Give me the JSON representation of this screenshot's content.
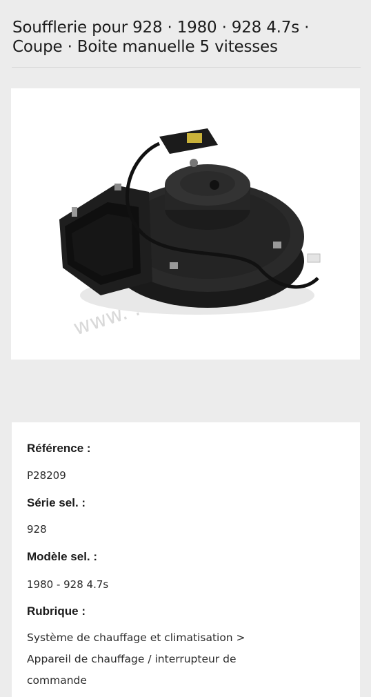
{
  "product": {
    "title_line1": "Soufflerie pour 928 · 1980 · 928 4.7s ·",
    "title_line2": "Coupe · Boite manuelle 5 vitesses",
    "image_alt": "Soufflerie (blower motor)",
    "watermark": "www.                    .com"
  },
  "details": {
    "reference_label": "Référence :",
    "reference_value": "P28209",
    "serie_label": "Série sel. :",
    "serie_value": "928",
    "modele_label": "Modèle sel. :",
    "modele_value": "1980 - 928 4.7s",
    "rubrique_label": "Rubrique :",
    "rubrique_line1": "Système de chauffage et climatisation >",
    "rubrique_line2": "Appareil de chauffage / interrupteur de",
    "rubrique_line3": "commande"
  }
}
